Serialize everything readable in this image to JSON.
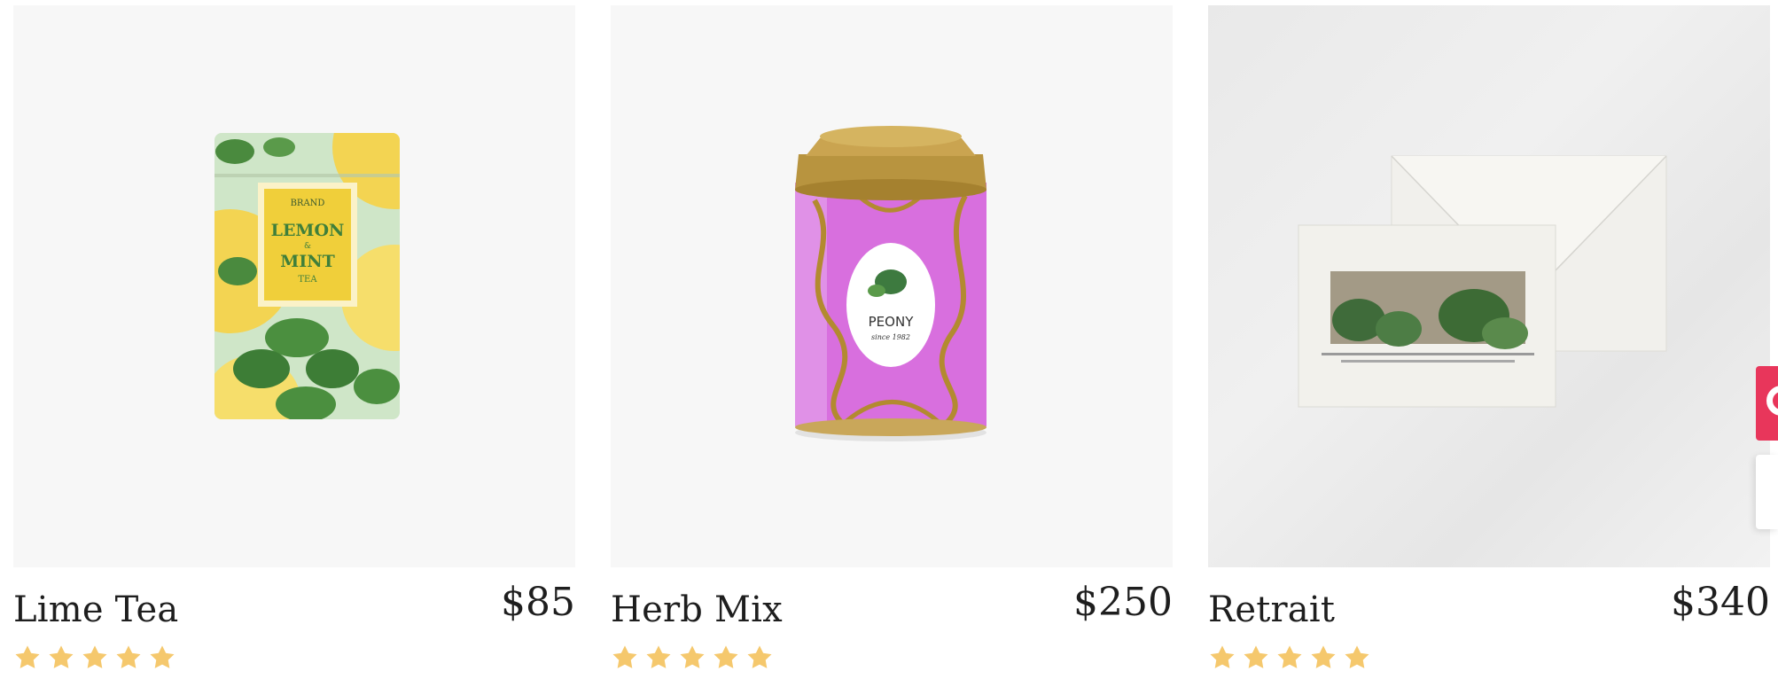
{
  "products": [
    {
      "name": "Lime Tea",
      "price": "$85",
      "rating": 5,
      "image_text": {
        "brand": "BRAND",
        "line1": "LEMON",
        "amp": "&",
        "line2": "MINT",
        "line3": "TEA"
      }
    },
    {
      "name": "Herb Mix",
      "price": "$250",
      "rating": 5,
      "image_text": {
        "brand": "PEONY",
        "tagline": "since 1982"
      }
    },
    {
      "name": "Retrait",
      "price": "$340",
      "rating": 5
    }
  ],
  "colors": {
    "star": "#f5c86d",
    "tile_background": "#f7f7f7",
    "floating_tab": "#e8365b"
  },
  "icons": {
    "rating": "star-icon",
    "floating_widget": "chat-widget-icon"
  }
}
